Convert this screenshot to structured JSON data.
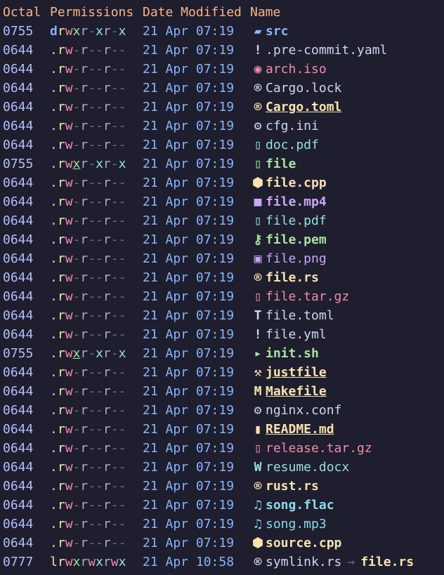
{
  "headers": {
    "octal": "Octal",
    "permissions": "Permissions",
    "date": "Date Modified",
    "name": "Name"
  },
  "colors": {
    "background": "#1e1e2e",
    "header": "#fab387",
    "octal": "#b4befe",
    "date": "#89b4fa",
    "read": "#f9e2af",
    "write": "#f38ba8",
    "exec": "#a6e3a1"
  },
  "rows": [
    {
      "octal": "0755",
      "perm": "drwxr-xr-x",
      "ptype": "d",
      "date": "21 Apr 07:19",
      "icon": "folder-icon",
      "glyph": "▰",
      "icon_color": "#89b4fa",
      "name": "src",
      "color": "#89b4fa",
      "bold": true,
      "ul": false
    },
    {
      "octal": "0644",
      "perm": ".rw-r--r--",
      "ptype": "dot",
      "date": "21 Apr 07:19",
      "icon": "exclamation-icon",
      "glyph": "!",
      "icon_color": "#cdd6f4",
      "name": ".pre-commit.yaml",
      "color": "#cdd6f4",
      "bold": false,
      "ul": false
    },
    {
      "octal": "0644",
      "perm": ".rw-r--r--",
      "ptype": "dot",
      "date": "21 Apr 07:19",
      "icon": "disc-icon",
      "glyph": "◉",
      "icon_color": "#f38ba8",
      "name": "arch.iso",
      "color": "#f38ba8",
      "bold": false,
      "ul": false
    },
    {
      "octal": "0644",
      "perm": ".rw-r--r--",
      "ptype": "dot",
      "date": "21 Apr 07:19",
      "icon": "rust-icon",
      "glyph": "®",
      "icon_color": "#cdd6f4",
      "name": "Cargo.lock",
      "color": "#cdd6f4",
      "bold": false,
      "ul": false
    },
    {
      "octal": "0644",
      "perm": ".rw-r--r--",
      "ptype": "dot",
      "date": "21 Apr 07:19",
      "icon": "rust-icon",
      "glyph": "®",
      "icon_color": "#f9e2af",
      "name": "Cargo.toml",
      "color": "#f9e2af",
      "bold": true,
      "ul": true
    },
    {
      "octal": "0644",
      "perm": ".rw-r--r--",
      "ptype": "dot",
      "date": "21 Apr 07:19",
      "icon": "gear-icon",
      "glyph": "⚙",
      "icon_color": "#cdd6f4",
      "name": "cfg.ini",
      "color": "#cdd6f4",
      "bold": false,
      "ul": false
    },
    {
      "octal": "0644",
      "perm": ".rw-r--r--",
      "ptype": "dot",
      "date": "21 Apr 07:19",
      "icon": "pdf-icon",
      "glyph": "▯",
      "icon_color": "#94e2d5",
      "name": "doc.pdf",
      "color": "#94e2d5",
      "bold": false,
      "ul": false
    },
    {
      "octal": "0755",
      "perm": ".rwxr-xr-x",
      "ptype": "dot",
      "date": "21 Apr 07:19",
      "icon": "file-icon",
      "glyph": "▯",
      "icon_color": "#a6e3a1",
      "name": "file",
      "color": "#a6e3a1",
      "bold": true,
      "ul": false,
      "xul": true
    },
    {
      "octal": "0644",
      "perm": ".rw-r--r--",
      "ptype": "dot",
      "date": "21 Apr 07:19",
      "icon": "cpp-icon",
      "glyph": "⬢",
      "icon_color": "#f9e2af",
      "name": "file.cpp",
      "color": "#f9e2af",
      "bold": true,
      "ul": false
    },
    {
      "octal": "0644",
      "perm": ".rw-r--r--",
      "ptype": "dot",
      "date": "21 Apr 07:19",
      "icon": "video-icon",
      "glyph": "■",
      "icon_color": "#cba6f7",
      "name": "file.mp4",
      "color": "#cba6f7",
      "bold": true,
      "ul": false
    },
    {
      "octal": "0644",
      "perm": ".rw-r--r--",
      "ptype": "dot",
      "date": "21 Apr 07:19",
      "icon": "pdf-icon",
      "glyph": "▯",
      "icon_color": "#94e2d5",
      "name": "file.pdf",
      "color": "#94e2d5",
      "bold": false,
      "ul": false
    },
    {
      "octal": "0644",
      "perm": ".rw-r--r--",
      "ptype": "dot",
      "date": "21 Apr 07:19",
      "icon": "key-icon",
      "glyph": "⚷",
      "icon_color": "#a6e3a1",
      "name": "file.pem",
      "color": "#a6e3a1",
      "bold": true,
      "ul": false
    },
    {
      "octal": "0644",
      "perm": ".rw-r--r--",
      "ptype": "dot",
      "date": "21 Apr 07:19",
      "icon": "image-icon",
      "glyph": "▣",
      "icon_color": "#cba6f7",
      "name": "file.png",
      "color": "#cba6f7",
      "bold": false,
      "ul": false
    },
    {
      "octal": "0644",
      "perm": ".rw-r--r--",
      "ptype": "dot",
      "date": "21 Apr 07:19",
      "icon": "rust-icon",
      "glyph": "®",
      "icon_color": "#f9e2af",
      "name": "file.rs",
      "color": "#f9e2af",
      "bold": true,
      "ul": false
    },
    {
      "octal": "0644",
      "perm": ".rw-r--r--",
      "ptype": "dot",
      "date": "21 Apr 07:19",
      "icon": "archive-icon",
      "glyph": "▯",
      "icon_color": "#f38ba8",
      "name": "file.tar.gz",
      "color": "#f38ba8",
      "bold": false,
      "ul": false
    },
    {
      "octal": "0644",
      "perm": ".rw-r--r--",
      "ptype": "dot",
      "date": "21 Apr 07:19",
      "icon": "toml-icon",
      "glyph": "T",
      "icon_color": "#cdd6f4",
      "name": "file.toml",
      "color": "#cdd6f4",
      "bold": false,
      "ul": false
    },
    {
      "octal": "0644",
      "perm": ".rw-r--r--",
      "ptype": "dot",
      "date": "21 Apr 07:19",
      "icon": "exclamation-icon",
      "glyph": "!",
      "icon_color": "#cdd6f4",
      "name": "file.yml",
      "color": "#cdd6f4",
      "bold": false,
      "ul": false
    },
    {
      "octal": "0755",
      "perm": ".rwxr-xr-x",
      "ptype": "dot",
      "date": "21 Apr 07:19",
      "icon": "terminal-icon",
      "glyph": "▸",
      "icon_color": "#a6e3a1",
      "name": "init.sh",
      "color": "#a6e3a1",
      "bold": true,
      "ul": false,
      "xul": true
    },
    {
      "octal": "0644",
      "perm": ".rw-r--r--",
      "ptype": "dot",
      "date": "21 Apr 07:19",
      "icon": "wrench-icon",
      "glyph": "⚒",
      "icon_color": "#f9e2af",
      "name": "justfile",
      "color": "#f9e2af",
      "bold": true,
      "ul": true
    },
    {
      "octal": "0644",
      "perm": ".rw-r--r--",
      "ptype": "dot",
      "date": "21 Apr 07:19",
      "icon": "makefile-icon",
      "glyph": "M",
      "icon_color": "#f9e2af",
      "name": "Makefile",
      "color": "#f9e2af",
      "bold": true,
      "ul": true
    },
    {
      "octal": "0644",
      "perm": ".rw-r--r--",
      "ptype": "dot",
      "date": "21 Apr 07:19",
      "icon": "gear-icon",
      "glyph": "⚙",
      "icon_color": "#cdd6f4",
      "name": "nginx.conf",
      "color": "#cdd6f4",
      "bold": false,
      "ul": false
    },
    {
      "octal": "0644",
      "perm": ".rw-r--r--",
      "ptype": "dot",
      "date": "21 Apr 07:19",
      "icon": "book-icon",
      "glyph": "▮",
      "icon_color": "#f9e2af",
      "name": "README.md",
      "color": "#f9e2af",
      "bold": true,
      "ul": true
    },
    {
      "octal": "0644",
      "perm": ".rw-r--r--",
      "ptype": "dot",
      "date": "21 Apr 07:19",
      "icon": "archive-icon",
      "glyph": "▯",
      "icon_color": "#f38ba8",
      "name": "release.tar.gz",
      "color": "#f38ba8",
      "bold": false,
      "ul": false
    },
    {
      "octal": "0644",
      "perm": ".rw-r--r--",
      "ptype": "dot",
      "date": "21 Apr 07:19",
      "icon": "word-doc-icon",
      "glyph": "W",
      "icon_color": "#94e2d5",
      "name": "resume.docx",
      "color": "#94e2d5",
      "bold": false,
      "ul": false
    },
    {
      "octal": "0644",
      "perm": ".rw-r--r--",
      "ptype": "dot",
      "date": "21 Apr 07:19",
      "icon": "rust-icon",
      "glyph": "®",
      "icon_color": "#f9e2af",
      "name": "rust.rs",
      "color": "#f9e2af",
      "bold": true,
      "ul": false
    },
    {
      "octal": "0644",
      "perm": ".rw-r--r--",
      "ptype": "dot",
      "date": "21 Apr 07:19",
      "icon": "music-icon",
      "glyph": "♫",
      "icon_color": "#89dceb",
      "name": "song.flac",
      "color": "#89dceb",
      "bold": true,
      "ul": false
    },
    {
      "octal": "0644",
      "perm": ".rw-r--r--",
      "ptype": "dot",
      "date": "21 Apr 07:19",
      "icon": "music-icon",
      "glyph": "♫",
      "icon_color": "#89dceb",
      "name": "song.mp3",
      "color": "#89dceb",
      "bold": false,
      "ul": false
    },
    {
      "octal": "0644",
      "perm": ".rw-r--r--",
      "ptype": "dot",
      "date": "21 Apr 07:19",
      "icon": "cpp-icon",
      "glyph": "⬢",
      "icon_color": "#f9e2af",
      "name": "source.cpp",
      "color": "#f9e2af",
      "bold": true,
      "ul": false
    },
    {
      "octal": "0777",
      "perm": "lrwxrwxrwx",
      "ptype": "l",
      "date": "21 Apr 10:58",
      "icon": "rust-icon",
      "glyph": "®",
      "icon_color": "#cdd6f4",
      "name": "symlink.rs",
      "color": "#cdd6f4",
      "bold": false,
      "ul": false,
      "link_arrow": "→",
      "link_target": "file.rs",
      "link_color": "#f9e2af"
    }
  ]
}
